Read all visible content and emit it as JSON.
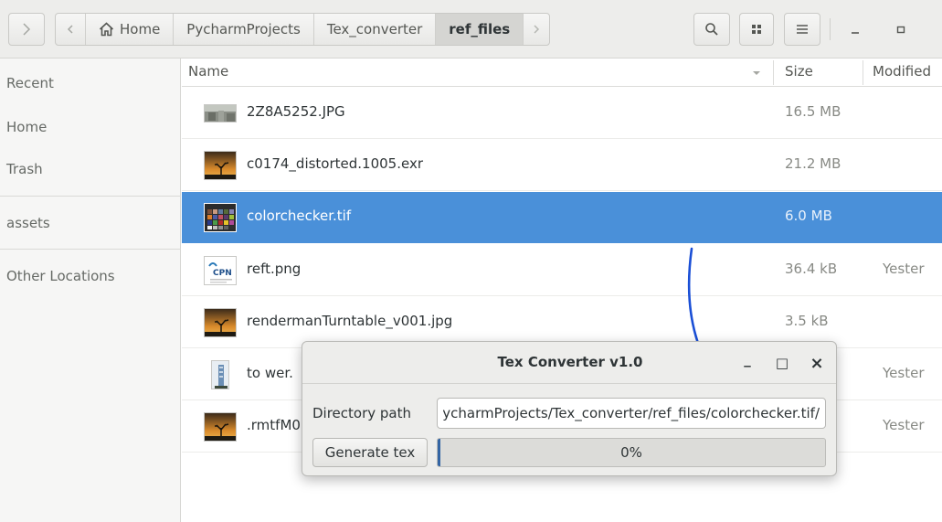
{
  "toolbar": {
    "breadcrumbs": [
      "Home",
      "PycharmProjects",
      "Tex_converter",
      "ref_files"
    ],
    "icons": {
      "forward": "chevron-right-icon",
      "back": "chevron-left-icon",
      "home": "home-icon",
      "search": "search-icon",
      "view": "grid-view-icon",
      "menu": "hamburger-menu-icon",
      "minimize": "minimize-icon",
      "maximize": "maximize-icon"
    }
  },
  "sidebar": {
    "items": [
      {
        "label": "Recent"
      },
      {
        "label": "Home"
      },
      {
        "label": "Trash"
      },
      {
        "label": "assets"
      },
      {
        "label": "Other Locations"
      }
    ]
  },
  "list": {
    "columns": {
      "name": "Name",
      "size": "Size",
      "modified": "Modified"
    },
    "files": [
      {
        "name": "2Z8A5252.JPG",
        "size": "16.5 MB",
        "modified": "",
        "thumb": "photo"
      },
      {
        "name": "c0174_distorted.1005.exr",
        "size": "21.2 MB",
        "modified": "",
        "thumb": "sunset"
      },
      {
        "name": "colorchecker.tif",
        "size": "6.0 MB",
        "modified": "",
        "thumb": "colorchecker",
        "selected": true
      },
      {
        "name": "reft.png",
        "size": "36.4 kB",
        "modified": "Yester",
        "thumb": "cpn-logo"
      },
      {
        "name": "rendermanTurntable_v001.jpg",
        "size": "3.5 kB",
        "modified": "",
        "thumb": "sunset"
      },
      {
        "name": "to wer.",
        "size": "",
        "modified": "Yester",
        "thumb": "tower"
      },
      {
        "name": ".rmtfM0",
        "size": "",
        "modified": "Yester",
        "thumb": "sunset"
      }
    ]
  },
  "dialog": {
    "title": "Tex Converter v1.0",
    "directory_label": "Directory path",
    "directory_value": "/home/user/PycharmProjects/Tex_converter/ref_files/colorchecker.tif",
    "generate_label": "Generate tex",
    "progress_text": "0%",
    "progress_value": 0,
    "minimize_glyph": "_",
    "maximize_glyph": "□",
    "close_glyph": "×"
  },
  "colors": {
    "selection": "#4a90d9",
    "annotation": "#1a4fd6",
    "progress": "#3465a4"
  }
}
